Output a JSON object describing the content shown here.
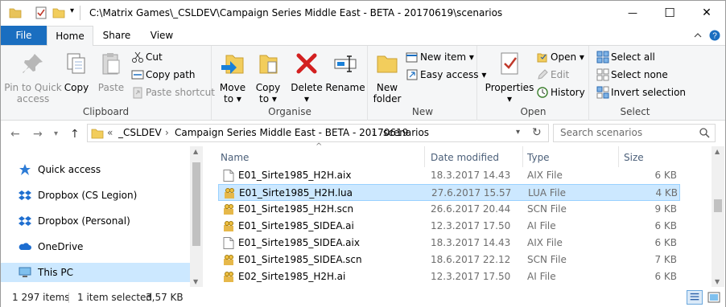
{
  "window": {
    "title": "C:\\Matrix Games\\_CSLDEV\\Campaign Series Middle East - BETA - 20170619\\scenarios",
    "minimize_glyph": "—",
    "maximize_glyph": "☐",
    "close_glyph": "✕"
  },
  "tabs": {
    "file": "File",
    "home": "Home",
    "share": "Share",
    "view": "View"
  },
  "ribbon": {
    "clipboard": {
      "label": "Clipboard",
      "pin": [
        "Pin to Quick",
        "access"
      ],
      "copy": "Copy",
      "paste": "Paste",
      "cut": "Cut",
      "copy_path": "Copy path",
      "paste_shortcut": "Paste shortcut"
    },
    "organise": {
      "label": "Organise",
      "move_to": [
        "Move",
        "to ▾"
      ],
      "copy_to": [
        "Copy",
        "to ▾"
      ],
      "delete": [
        "Delete",
        "▾"
      ],
      "rename": "Rename"
    },
    "new": {
      "label": "New",
      "new_folder": [
        "New",
        "folder"
      ],
      "new_item": "New item ▾",
      "easy_access": "Easy access ▾"
    },
    "open": {
      "label": "Open",
      "properties": [
        "Properties",
        "▾"
      ],
      "open": "Open ▾",
      "edit": "Edit",
      "history": "History"
    },
    "select": {
      "label": "Select",
      "select_all": "Select all",
      "select_none": "Select none",
      "invert": "Invert selection"
    }
  },
  "address": {
    "chevrons": "«",
    "crumbs": [
      "_CSLDEV",
      "Campaign Series Middle East - BETA - 20170619",
      "scenarios"
    ],
    "separator": "›",
    "search_placeholder": "Search scenarios"
  },
  "nav_pane": [
    {
      "label": "Quick access",
      "icon": "star-icon"
    },
    {
      "label": "Dropbox (CS Legion)",
      "icon": "dropbox-icon"
    },
    {
      "label": "Dropbox (Personal)",
      "icon": "dropbox-icon"
    },
    {
      "label": "OneDrive",
      "icon": "onedrive-icon"
    },
    {
      "label": "This PC",
      "icon": "pc-icon"
    }
  ],
  "columns": {
    "name": "Name",
    "date": "Date modified",
    "type": "Type",
    "size": "Size"
  },
  "files": [
    {
      "name": "E01_Sirte1985_H2H.aix",
      "date": "18.3.2017 14.43",
      "type": "AIX File",
      "size": "6 KB",
      "icon": "file-icon"
    },
    {
      "name": "E01_Sirte1985_H2H.lua",
      "date": "27.6.2017 15.57",
      "type": "LUA File",
      "size": "4 KB",
      "icon": "script-file-icon"
    },
    {
      "name": "E01_Sirte1985_H2H.scn",
      "date": "26.6.2017 20.44",
      "type": "SCN File",
      "size": "9 KB",
      "icon": "script-file-icon"
    },
    {
      "name": "E01_Sirte1985_SIDEA.ai",
      "date": "12.3.2017 17.50",
      "type": "AI File",
      "size": "6 KB",
      "icon": "script-file-icon"
    },
    {
      "name": "E01_Sirte1985_SIDEA.aix",
      "date": "18.3.2017 14.43",
      "type": "AIX File",
      "size": "6 KB",
      "icon": "file-icon"
    },
    {
      "name": "E01_Sirte1985_SIDEA.scn",
      "date": "18.6.2017 22.12",
      "type": "SCN File",
      "size": "7 KB",
      "icon": "script-file-icon"
    },
    {
      "name": "E02_Sirte1985_H2H.ai",
      "date": "12.3.2017 17.50",
      "type": "AI File",
      "size": "6 KB",
      "icon": "script-file-icon"
    }
  ],
  "status": {
    "item_count": "1 297 items",
    "selection": "1 item selected",
    "selection_size": "3,57 KB"
  },
  "colors": {
    "accent": "#1a6ec0",
    "selection": "#cce8ff",
    "selection_border": "#99d1ff"
  }
}
